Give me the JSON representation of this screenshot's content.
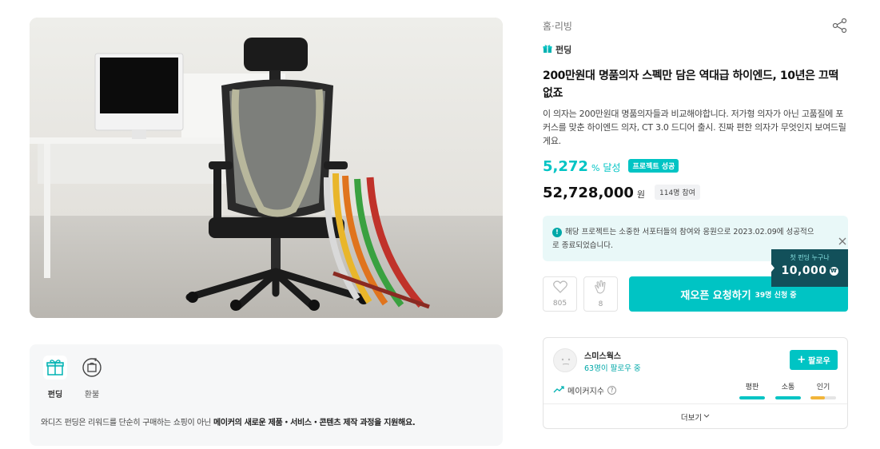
{
  "breadcrumb": "홈·리빙",
  "icons": {
    "share": "share-icon",
    "gift": "gift-icon",
    "refund": "refund-icon",
    "info": "info-icon",
    "close": "close-icon",
    "heart": "heart-icon",
    "clap": "clap-icon",
    "plus": "plus-icon",
    "trend": "trend-up-icon",
    "help": "question-icon",
    "chevron": "chevron-down-icon"
  },
  "colors": {
    "accent": "#00c4c4",
    "accent_dark": "#00a8a8",
    "notice_bg": "#e9f8f8",
    "promo_bg": "#12505a",
    "popularity": "#f2b53a"
  },
  "funding_tag": "펀딩",
  "title": "200만원대 명품의자 스펙만 담은 역대급 하이엔드, 10년은 끄떡없죠",
  "description": "이 의자는 200만원대 명품의자들과 비교해야합니다. 저가형 의자가 아닌 고품질에 포커스를 맞춘 하이엔드 의자, CT 3.0 드디어 출시. 진짜 편한 의자가 무엇인지 보여드릴게요.",
  "achievement": {
    "rate": "5,272",
    "unit": "%",
    "label": "달성",
    "badge": "프로젝트 성공"
  },
  "amount": {
    "value": "52,728,000",
    "unit": "원",
    "supporters": "114명 참여"
  },
  "notice": {
    "text": "해당 프로젝트는 소중한 서포터들의 참여와 응원으로 2023.02.09에 성공적으로 종료되었습니다."
  },
  "promo": {
    "label": "첫 펀딩 누구나",
    "value": "10,000",
    "currency": "₩"
  },
  "actions": {
    "like_count": "805",
    "cheer_count": "8",
    "reapply_label": "재오픈 요청하기",
    "reapply_sub": "39명 신청 중"
  },
  "policy": {
    "tabs": [
      {
        "label": "펀딩"
      },
      {
        "label": "환불"
      }
    ],
    "desc_prefix": "와디즈 펀딩은 리워드를 단순히 구매하는 쇼핑이 아닌 ",
    "desc_bold": "메이커의 새로운 제품・서비스・콘텐츠 제작 과정을 지원해요."
  },
  "maker": {
    "name": "스미스웍스",
    "followers": "63명이 팔로우 중",
    "follow_label": "팔로우",
    "index_label": "메이커지수",
    "metrics": [
      {
        "label": "평판",
        "level": 1.0
      },
      {
        "label": "소통",
        "level": 1.0
      },
      {
        "label": "인기",
        "level": 0.55
      }
    ],
    "more_label": "더보기"
  }
}
